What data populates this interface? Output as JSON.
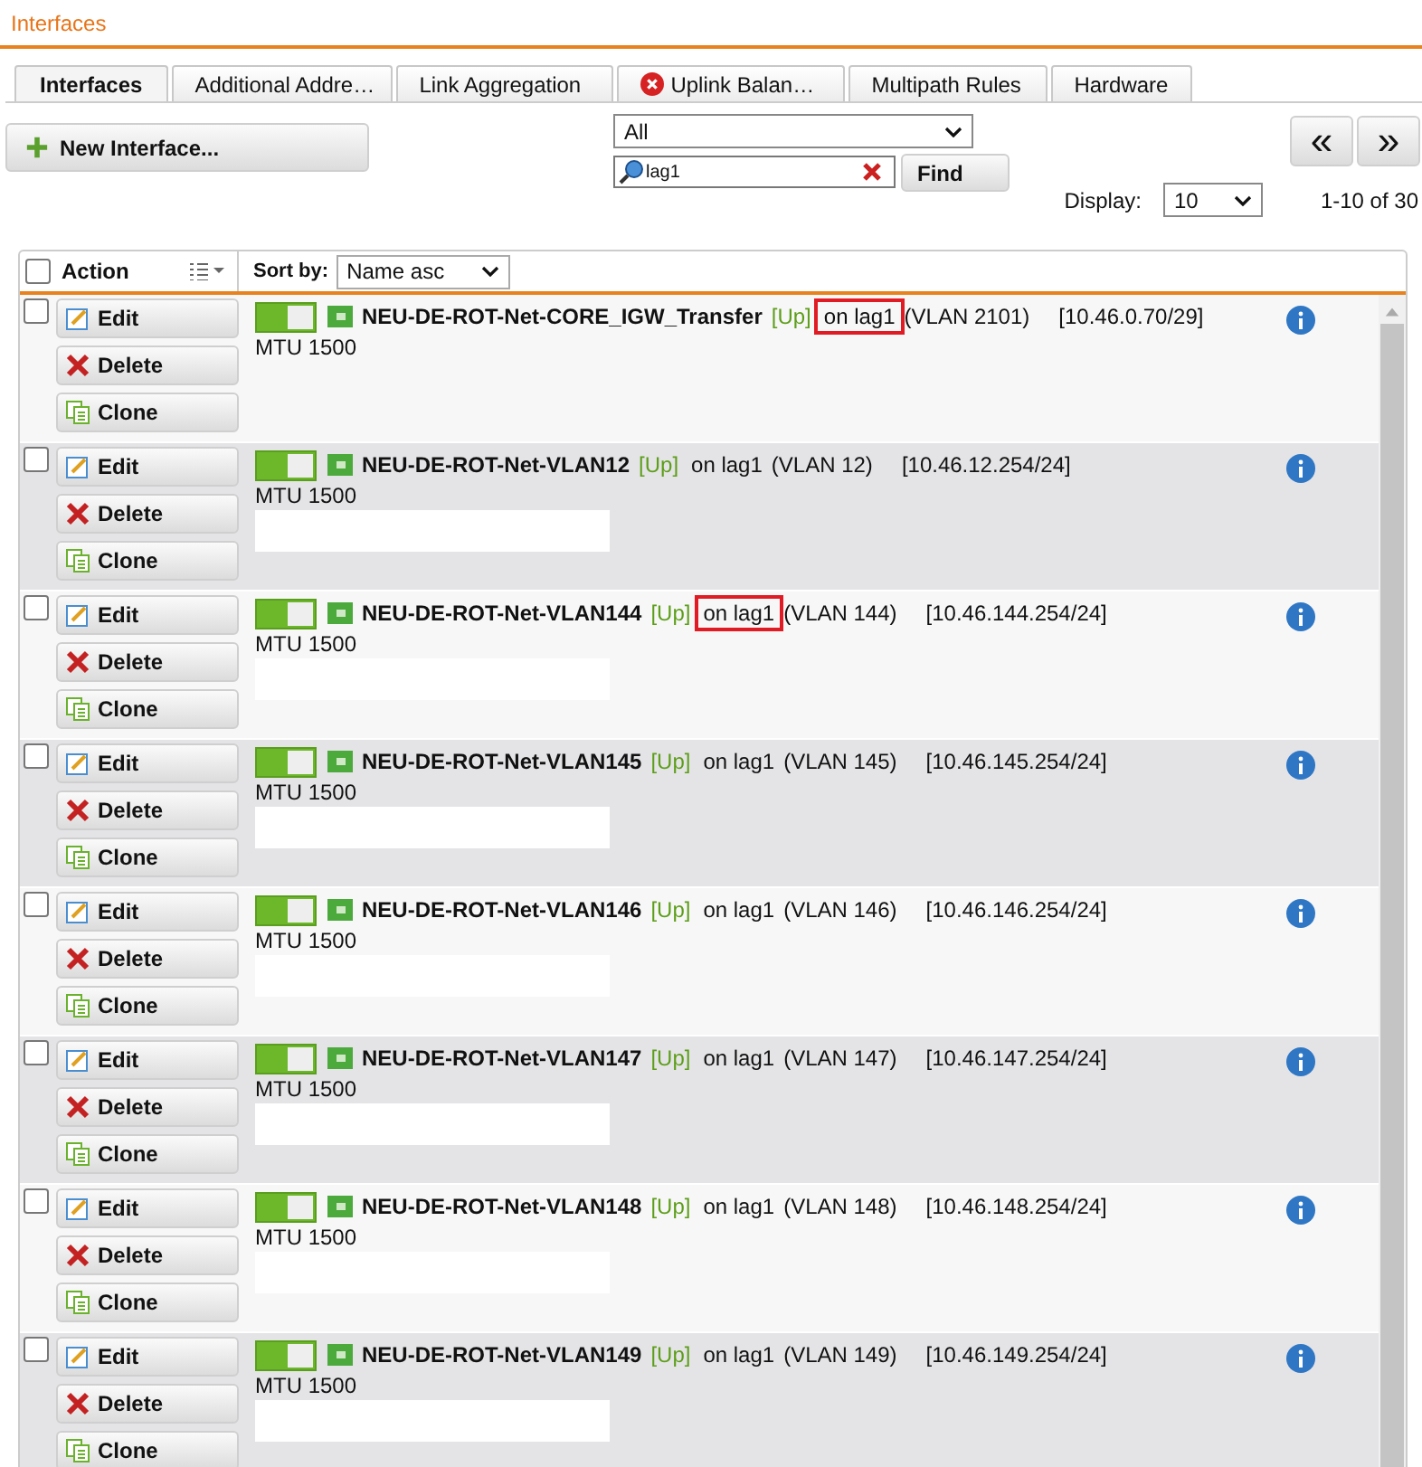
{
  "page_title": "Interfaces",
  "tabs": [
    {
      "label": "Interfaces",
      "selected": true,
      "warning": false
    },
    {
      "label": "Additional Addre…",
      "selected": false,
      "warning": false
    },
    {
      "label": "Link Aggregation",
      "selected": false,
      "warning": false
    },
    {
      "label": "Uplink Balan…",
      "selected": false,
      "warning": true
    },
    {
      "label": "Multipath Rules",
      "selected": false,
      "warning": false
    },
    {
      "label": "Hardware",
      "selected": false,
      "warning": false
    }
  ],
  "new_button": "New Interface...",
  "filter": {
    "value": "All"
  },
  "search": {
    "value": "lag1",
    "find_button": "Find"
  },
  "pager": {
    "prev": "«",
    "next": "»",
    "display_label": "Display:",
    "display_value": "10",
    "range": "1-10 of 30"
  },
  "table": {
    "select_all_checked": false,
    "action_header": "Action",
    "sort_label": "Sort by:",
    "sort_value": "Name asc"
  },
  "rows": [
    {
      "checked": false,
      "buttons": [
        "Edit",
        "Delete",
        "Clone"
      ],
      "name": "NEU-DE-ROT-Net-CORE_IGW_Transfer",
      "status": "[Up]",
      "link": "on lag1",
      "vlan": "(VLAN 2101)",
      "ip": "[10.46.0.70/29]",
      "mtu": "MTU 1500",
      "enabled": true,
      "highlighted": true,
      "redacted": false
    },
    {
      "checked": false,
      "buttons": [
        "Edit",
        "Delete",
        "Clone"
      ],
      "name": "NEU-DE-ROT-Net-VLAN12",
      "status": "[Up]",
      "link": "on lag1",
      "vlan": "(VLAN 12)",
      "ip": "[10.46.12.254/24]",
      "mtu": "MTU 1500",
      "enabled": true,
      "highlighted": false,
      "redacted": true
    },
    {
      "checked": false,
      "buttons": [
        "Edit",
        "Delete",
        "Clone"
      ],
      "name": "NEU-DE-ROT-Net-VLAN144",
      "status": "[Up]",
      "link": "on lag1",
      "vlan": "(VLAN 144)",
      "ip": "[10.46.144.254/24]",
      "mtu": "MTU 1500",
      "enabled": true,
      "highlighted": true,
      "redacted": true
    },
    {
      "checked": false,
      "buttons": [
        "Edit",
        "Delete",
        "Clone"
      ],
      "name": "NEU-DE-ROT-Net-VLAN145",
      "status": "[Up]",
      "link": "on lag1",
      "vlan": "(VLAN 145)",
      "ip": "[10.46.145.254/24]",
      "mtu": "MTU 1500",
      "enabled": true,
      "highlighted": false,
      "redacted": true
    },
    {
      "checked": false,
      "buttons": [
        "Edit",
        "Delete",
        "Clone"
      ],
      "name": "NEU-DE-ROT-Net-VLAN146",
      "status": "[Up]",
      "link": "on lag1",
      "vlan": "(VLAN 146)",
      "ip": "[10.46.146.254/24]",
      "mtu": "MTU 1500",
      "enabled": true,
      "highlighted": false,
      "redacted": true
    },
    {
      "checked": false,
      "buttons": [
        "Edit",
        "Delete",
        "Clone"
      ],
      "name": "NEU-DE-ROT-Net-VLAN147",
      "status": "[Up]",
      "link": "on lag1",
      "vlan": "(VLAN 147)",
      "ip": "[10.46.147.254/24]",
      "mtu": "MTU 1500",
      "enabled": true,
      "highlighted": false,
      "redacted": true
    },
    {
      "checked": false,
      "buttons": [
        "Edit",
        "Delete",
        "Clone"
      ],
      "name": "NEU-DE-ROT-Net-VLAN148",
      "status": "[Up]",
      "link": "on lag1",
      "vlan": "(VLAN 148)",
      "ip": "[10.46.148.254/24]",
      "mtu": "MTU 1500",
      "enabled": true,
      "highlighted": false,
      "redacted": true
    },
    {
      "checked": false,
      "buttons": [
        "Edit",
        "Delete",
        "Clone"
      ],
      "name": "NEU-DE-ROT-Net-VLAN149",
      "status": "[Up]",
      "link": "on lag1",
      "vlan": "(VLAN 149)",
      "ip": "[10.46.149.254/24]",
      "mtu": "MTU 1500",
      "enabled": true,
      "highlighted": false,
      "redacted": true
    }
  ]
}
